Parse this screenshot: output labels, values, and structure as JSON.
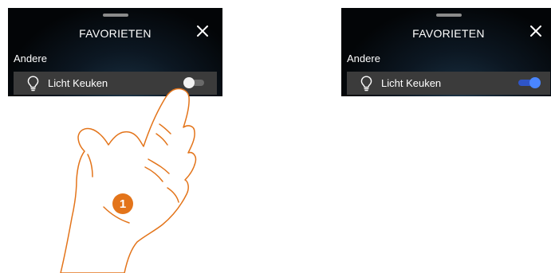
{
  "colors": {
    "accent": "#4a86ff",
    "hand_outline": "#e3741a",
    "step_badge": "#e3741a"
  },
  "panels": [
    {
      "state": "before",
      "title": "FAVORIETEN",
      "section": "Andere",
      "item": {
        "label": "Licht Keuken",
        "icon": "lightbulb-icon",
        "toggle_on": false
      }
    },
    {
      "state": "after",
      "title": "FAVORIETEN",
      "section": "Andere",
      "item": {
        "label": "Licht Keuken",
        "icon": "lightbulb-icon",
        "toggle_on": true
      }
    }
  ],
  "step_marker": "1",
  "icons": {
    "close": "close-icon",
    "hand": "pointing-hand-icon"
  }
}
